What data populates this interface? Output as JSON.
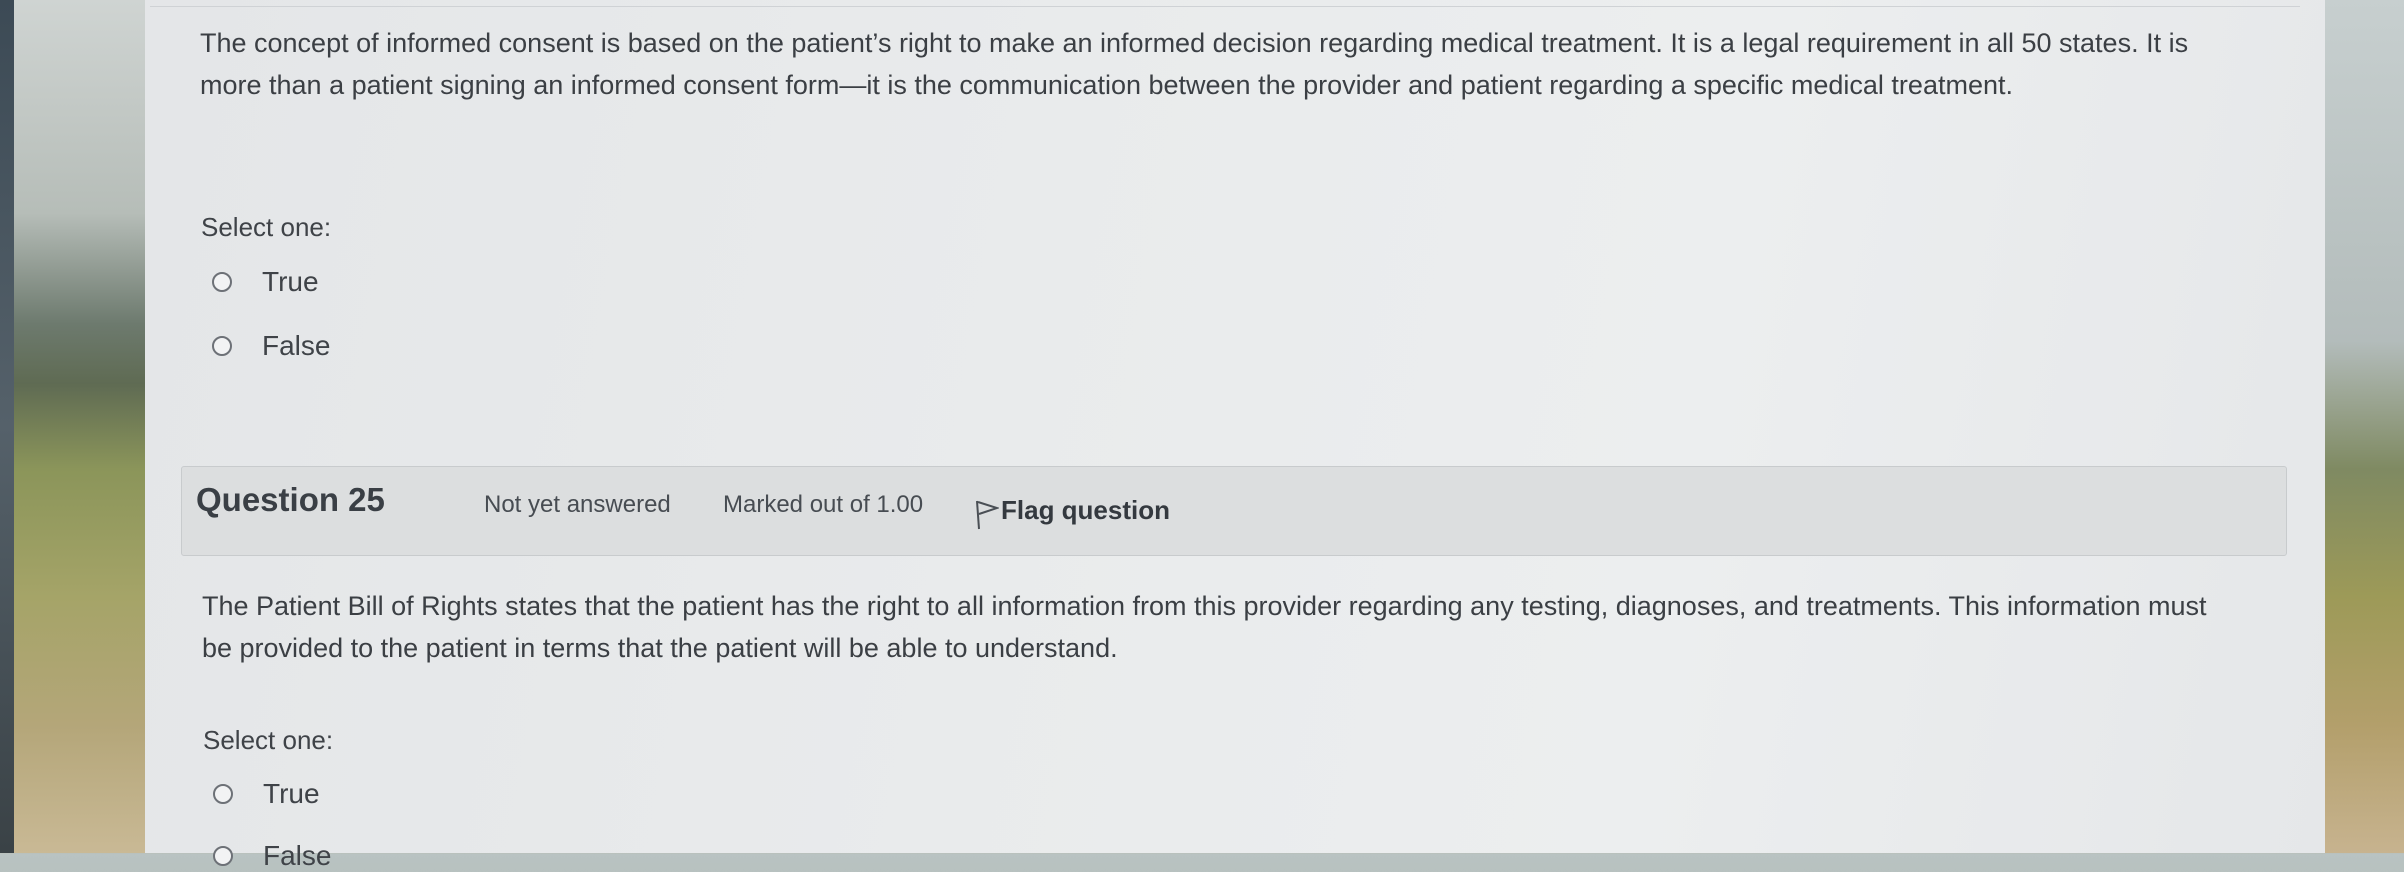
{
  "question24": {
    "text": "The concept of informed consent is based on the patient’s right to make an informed decision regarding medical treatment. It is a legal requirement in all 50 states. It is more than a patient signing an informed consent form—it is the communication between the provider and patient regarding a specific medical treatment.",
    "select_label": "Select one:",
    "options": [
      "True",
      "False"
    ]
  },
  "question25": {
    "title": "Question 25",
    "status": "Not yet answered",
    "marks": "Marked out of 1.00",
    "flag_label": "Flag question",
    "text": "The Patient Bill of Rights states that the patient has the right to all information from this provider regarding any testing, diagnoses, and treatments. This information must be provided to the patient in terms that the patient will be able to understand.",
    "select_label": "Select one:",
    "options": [
      "True",
      "False"
    ]
  }
}
